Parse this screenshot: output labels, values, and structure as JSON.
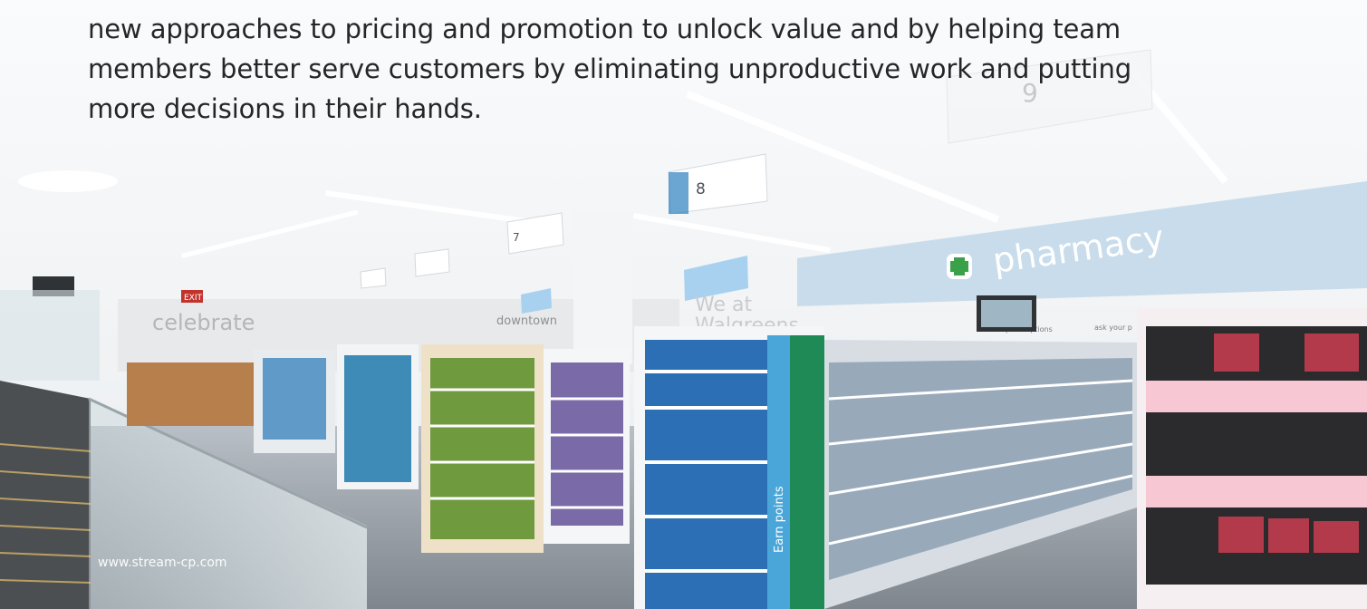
{
  "intro": {
    "lines": [
      "new approaches to pricing and promotion to unlock value and by helping team",
      "members better serve customers by eliminating unproductive work and putting",
      "more decisions in their hands."
    ]
  },
  "photo": {
    "signs": {
      "pharmacy": "pharmacy",
      "celebrate": "celebrate",
      "we_at": "We at",
      "walgreens": "Walgreens",
      "exit": "EXIT",
      "aisle_8": "8",
      "aisle_9": "9",
      "aisle_7": "7",
      "earn_points": "Earn points",
      "counter_left": "prescriptions",
      "counter_right": "ask your p",
      "downtown": "downtown"
    }
  },
  "watermark": "www.stream-cp.com",
  "colors": {
    "text": "#262626",
    "pharmacy_band": "#c7dbe9",
    "ceiling": "#f3f4f6",
    "floor": "#9aa1a8"
  }
}
